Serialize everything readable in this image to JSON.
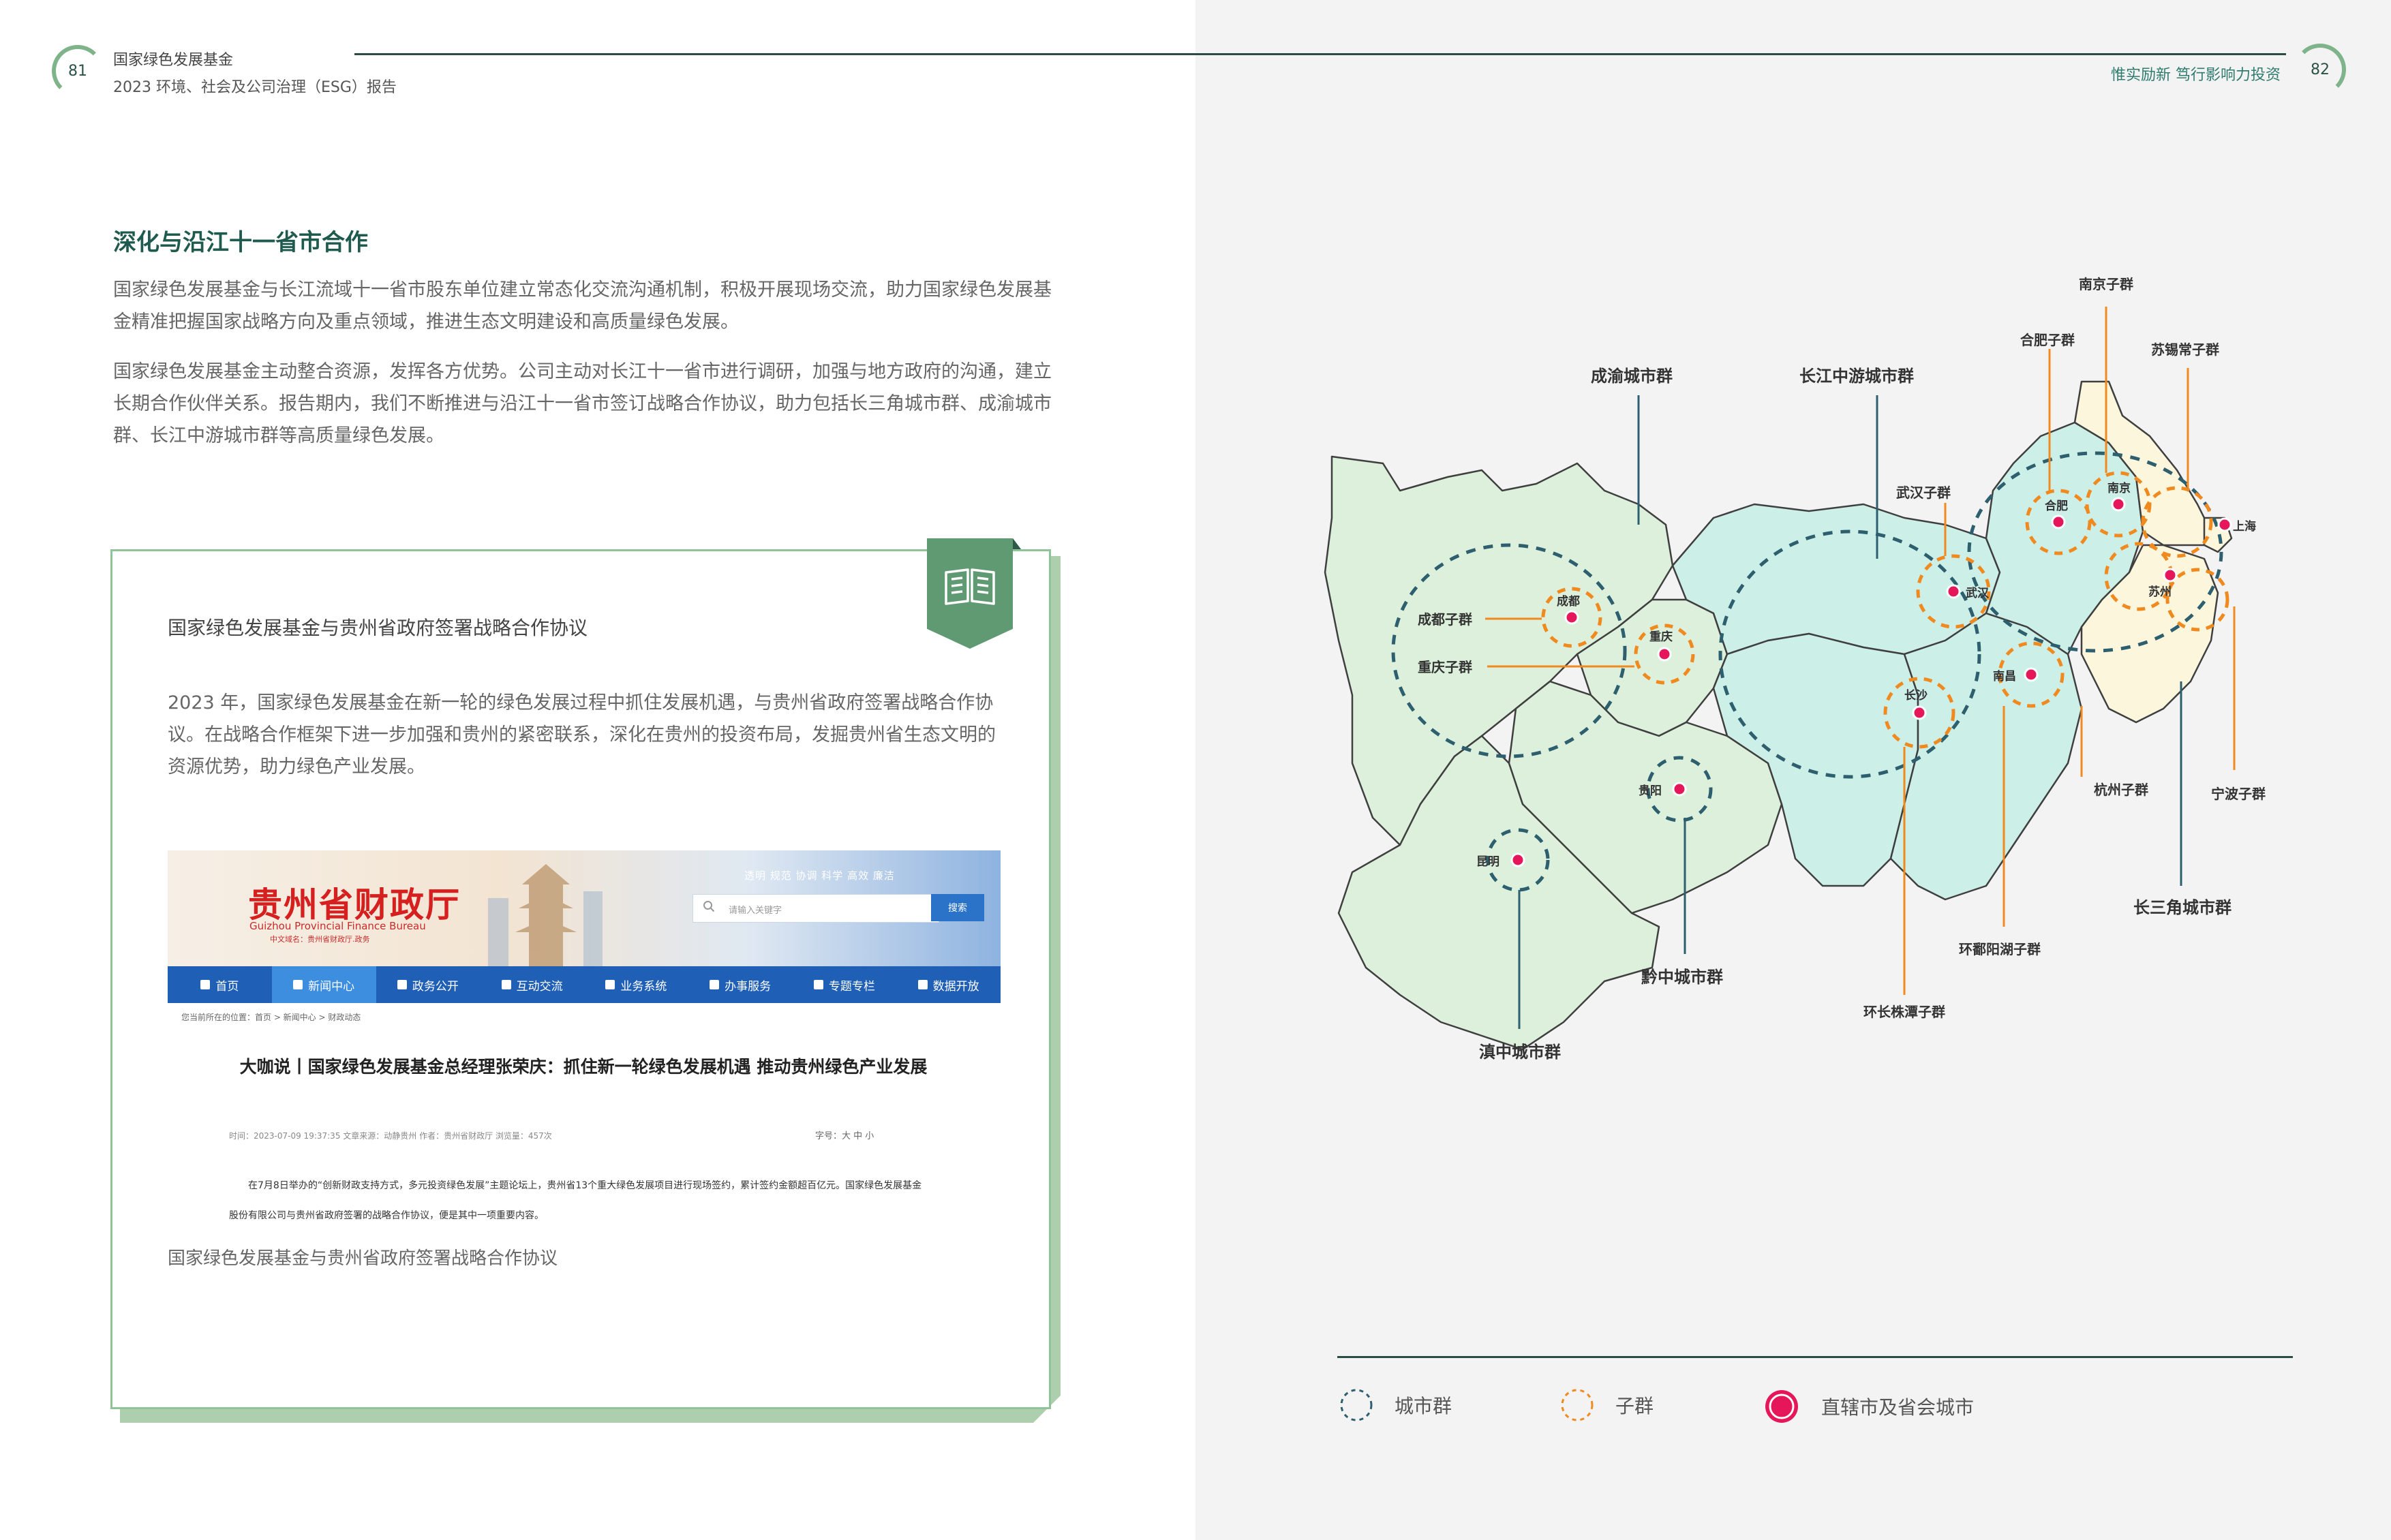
{
  "header": {
    "left_page_number": "81",
    "right_page_number": "82",
    "org_name": "国家绿色发展基金",
    "report_title": "2023  环境、社会及公司治理（ESG）报告",
    "slogan": "惟实励新 笃行影响力投资"
  },
  "section": {
    "title": "深化与沿江十一省市合作",
    "paragraphs": [
      "国家绿色发展基金与长江流域十一省市股东单位建立常态化交流沟通机制，积极开展现场交流，助力国家绿色发展基金精准把握国家战略方向及重点领域，推进生态文明建设和高质量绿色发展。",
      "国家绿色发展基金主动整合资源，发挥各方优势。公司主动对长江十一省市进行调研，加强与地方政府的沟通，建立长期合作伙伴关系。报告期内，我们不断推进与沿江十一省市签订战略合作协议，助力包括长三角城市群、成渝城市群、长江中游城市群等高质量绿色发展。"
    ]
  },
  "case_card": {
    "title": "国家绿色发展基金与贵州省政府签署战略合作协议",
    "body": "2023 年，国家绿色发展基金在新一轮的绿色发展过程中抓住发展机遇，与贵州省政府签署战略合作协议。在战略合作框架下进一步加强和贵州的紧密联系，深化在贵州的投资布局，发掘贵州省生态文明的资源优势，助力绿色产业发展。",
    "caption": "国家绿色发展基金与贵州省政府签署战略合作协议",
    "icon": "open-book-icon"
  },
  "screenshot": {
    "site_title": "贵州省财政厅",
    "site_subtitle": "Guizhou Provincial Finance Bureau",
    "site_subtitle2": "中文域名：贵州省财政厅.政务",
    "top_links": "透明  规范  协调  科学  高效  廉洁",
    "search_placeholder": "请输入关键字",
    "search_button": "搜索",
    "nav": [
      {
        "label": "首页",
        "active": false
      },
      {
        "label": "新闻中心",
        "active": true
      },
      {
        "label": "政务公开",
        "active": false
      },
      {
        "label": "互动交流",
        "active": false
      },
      {
        "label": "业务系统",
        "active": false
      },
      {
        "label": "办事服务",
        "active": false
      },
      {
        "label": "专题专栏",
        "active": false
      },
      {
        "label": "数据开放",
        "active": false
      }
    ],
    "breadcrumb": "您当前所在的位置：首页 > 新闻中心 > 财政动态",
    "article_title": "大咖说丨国家绿色发展基金总经理张荣庆：抓住新一轮绿色发展机遇 推动贵州绿色产业发展",
    "article_meta": "时间：2023-07-09 19:37:35    文章来源：动静贵州    作者：贵州省财政厅    浏览量：457次",
    "font_size_label": "字号：大 中 小",
    "article_body": "在7月8日举办的“创新财政支持方式，多元投资绿色发展”主题论坛上，贵州省13个重大绿色发展项目进行现场签约，累计签约金额超百亿元。国家绿色发展基金股份有限公司与贵州省政府签署的战略合作协议，便是其中一项重要内容。"
  },
  "map": {
    "city_clusters": [
      "成渝城市群",
      "长江中游城市群",
      "长三角城市群",
      "黔中城市群",
      "滇中城市群"
    ],
    "sub_groups": [
      "成都子群",
      "重庆子群",
      "武汉子群",
      "合肥子群",
      "南京子群",
      "苏锡常子群",
      "杭州子群",
      "宁波子群",
      "环鄱阳湖子群",
      "环长株潭子群"
    ],
    "cities": [
      "成都",
      "重庆",
      "武汉",
      "合肥",
      "南京",
      "上海",
      "苏州",
      "长沙",
      "南昌",
      "贵阳",
      "昆明"
    ],
    "colors": {
      "cluster_ring": "#2d5f6e",
      "subgroup_ring": "#f08a1f",
      "city_dot": "#e5175a",
      "region_green": "#dcf0dc",
      "region_teal": "#ccefe8",
      "region_yellow": "#fbf6dc"
    }
  },
  "legend": [
    {
      "label": "城市群",
      "symbol": "dashed-ring-blue"
    },
    {
      "label": "子群",
      "symbol": "dashed-ring-orange"
    },
    {
      "label": "直辖市及省会城市",
      "symbol": "red-dot"
    }
  ]
}
